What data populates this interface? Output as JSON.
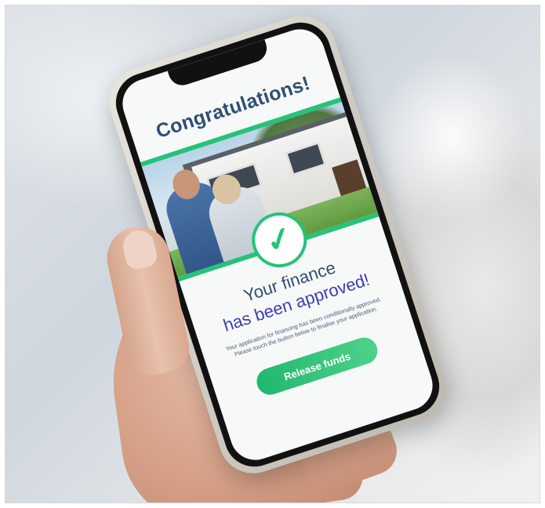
{
  "screen": {
    "title": "Congratulations!",
    "headline_line1": "Your finance",
    "headline_line2": "has been approved!",
    "body_text": "Your application for financing has been conditionally approved. Please touch the button below to finalise your application.",
    "primary_button": "Release funds",
    "check_glyph": "✓",
    "accent_color": "#27c27a",
    "title_color": "#2f4f73"
  }
}
